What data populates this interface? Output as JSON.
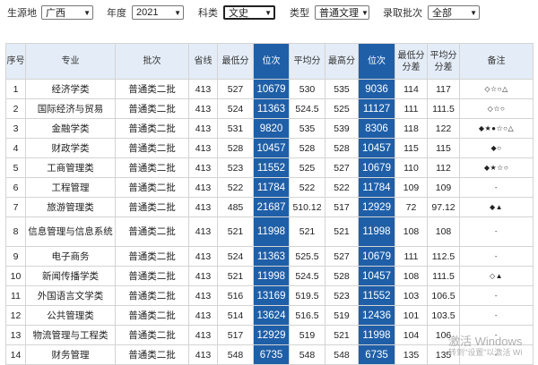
{
  "filters": {
    "source_label": "生源地",
    "source_value": "广西",
    "year_label": "年度",
    "year_value": "2021",
    "subject_label": "科类",
    "subject_value": "文史",
    "type_label": "类型",
    "type_value": "普通文理",
    "batch_label": "录取批次",
    "batch_value": "全部"
  },
  "colors": {
    "rank_bg": "#1f5fa8",
    "header_bg": "#e4ecf7"
  },
  "table": {
    "headers": [
      "序号",
      "专业",
      "批次",
      "省线",
      "最低分",
      "位次",
      "平均分",
      "最高分",
      "位次",
      "最低分分差",
      "平均分分差",
      "备注"
    ],
    "rows": [
      [
        "1",
        "经济学类",
        "普通类二批",
        "413",
        "527",
        "10679",
        "530",
        "535",
        "9036",
        "114",
        "117",
        "◇☆○△"
      ],
      [
        "2",
        "国际经济与贸易",
        "普通类二批",
        "413",
        "524",
        "11363",
        "524.5",
        "525",
        "11127",
        "111",
        "111.5",
        "◇☆○"
      ],
      [
        "3",
        "金融学类",
        "普通类二批",
        "413",
        "531",
        "9820",
        "535",
        "539",
        "8306",
        "118",
        "122",
        "◆★●☆○△"
      ],
      [
        "4",
        "财政学类",
        "普通类二批",
        "413",
        "528",
        "10457",
        "528",
        "528",
        "10457",
        "115",
        "115",
        "◆○"
      ],
      [
        "5",
        "工商管理类",
        "普通类二批",
        "413",
        "523",
        "11552",
        "525",
        "527",
        "10679",
        "110",
        "112",
        "◆★☆○"
      ],
      [
        "6",
        "工程管理",
        "普通类二批",
        "413",
        "522",
        "11784",
        "522",
        "522",
        "11784",
        "109",
        "109",
        "-"
      ],
      [
        "7",
        "旅游管理类",
        "普通类二批",
        "413",
        "485",
        "21687",
        "510.12",
        "517",
        "12929",
        "72",
        "97.12",
        "◆▲"
      ],
      [
        "8",
        "信息管理与信息系统",
        "普通类二批",
        "413",
        "521",
        "11998",
        "521",
        "521",
        "11998",
        "108",
        "108",
        "-"
      ],
      [
        "9",
        "电子商务",
        "普通类二批",
        "413",
        "524",
        "11363",
        "525.5",
        "527",
        "10679",
        "111",
        "112.5",
        "-"
      ],
      [
        "10",
        "新闻传播学类",
        "普通类二批",
        "413",
        "521",
        "11998",
        "524.5",
        "528",
        "10457",
        "108",
        "111.5",
        "◇▲"
      ],
      [
        "11",
        "外国语言文学类",
        "普通类二批",
        "413",
        "516",
        "13169",
        "519.5",
        "523",
        "11552",
        "103",
        "106.5",
        "-"
      ],
      [
        "12",
        "公共管理类",
        "普通类二批",
        "413",
        "514",
        "13624",
        "516.5",
        "519",
        "12436",
        "101",
        "103.5",
        "-"
      ],
      [
        "13",
        "物流管理与工程类",
        "普通类二批",
        "413",
        "517",
        "12929",
        "519",
        "521",
        "11998",
        "104",
        "106",
        "-"
      ],
      [
        "14",
        "财务管理",
        "普通类二批",
        "413",
        "548",
        "6735",
        "548",
        "548",
        "6735",
        "135",
        "135",
        "-"
      ]
    ]
  },
  "watermark": {
    "line1": "激活 Windows",
    "line2": "转到\"设置\"以激活 Wi"
  }
}
